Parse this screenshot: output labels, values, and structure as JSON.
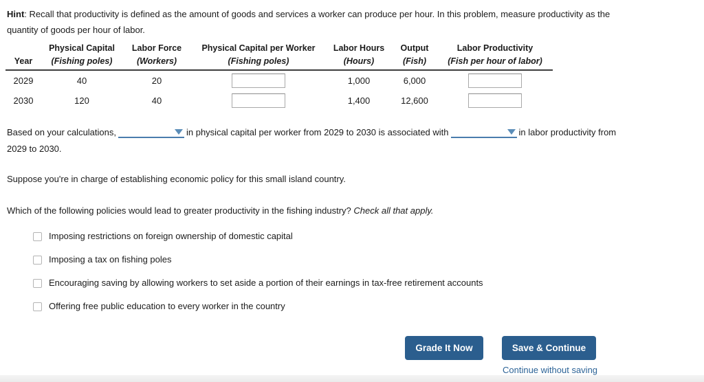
{
  "hint": {
    "label": "Hint",
    "separator": ": ",
    "text": "Recall that productivity is defined as the amount of goods and services a worker can produce per hour. In this problem, measure productivity as the quantity of goods per hour of labor."
  },
  "table": {
    "columns": [
      {
        "title": "",
        "unit": "Year"
      },
      {
        "title": "Physical Capital",
        "unit": "(Fishing poles)"
      },
      {
        "title": "Labor Force",
        "unit": "(Workers)"
      },
      {
        "title": "Physical Capital per Worker",
        "unit": "(Fishing poles)"
      },
      {
        "title": "Labor Hours",
        "unit": "(Hours)"
      },
      {
        "title": "Output",
        "unit": "(Fish)"
      },
      {
        "title": "Labor Productivity",
        "unit": "(Fish per hour of labor)"
      }
    ],
    "rows": [
      {
        "year": "2029",
        "physical_capital": "40",
        "labor_force": "20",
        "physical_capital_per_worker": "",
        "labor_hours": "1,000",
        "output": "6,000",
        "labor_productivity": ""
      },
      {
        "year": "2030",
        "physical_capital": "120",
        "labor_force": "40",
        "physical_capital_per_worker": "",
        "labor_hours": "1,400",
        "output": "12,600",
        "labor_productivity": ""
      }
    ]
  },
  "sentence": {
    "part1": "Based on your calculations,",
    "dropdown1_value": "",
    "part2": "in physical capital per worker from 2029 to 2030 is associated with",
    "dropdown2_value": "",
    "part3": "in labor productivity from 2029 to 2030."
  },
  "paragraphs": {
    "suppose": "Suppose you're in charge of establishing economic policy for this small island country.",
    "question": "Which of the following policies would lead to greater productivity in the fishing industry? ",
    "question_italic": "Check all that apply."
  },
  "options": [
    {
      "label": "Imposing restrictions on foreign ownership of domestic capital",
      "checked": false
    },
    {
      "label": "Imposing a tax on fishing poles",
      "checked": false
    },
    {
      "label": "Encouraging saving by allowing workers to set aside a portion of their earnings in tax-free retirement accounts",
      "checked": false
    },
    {
      "label": "Offering free public education to every worker in the country",
      "checked": false
    }
  ],
  "actions": {
    "grade_label": "Grade It Now",
    "save_label": "Save & Continue",
    "continue_without_saving_label": "Continue without saving"
  },
  "colors": {
    "button_blue": "#2b5e8e",
    "link_blue": "#2c6397",
    "dropdown_blue": "#4a7cad"
  }
}
